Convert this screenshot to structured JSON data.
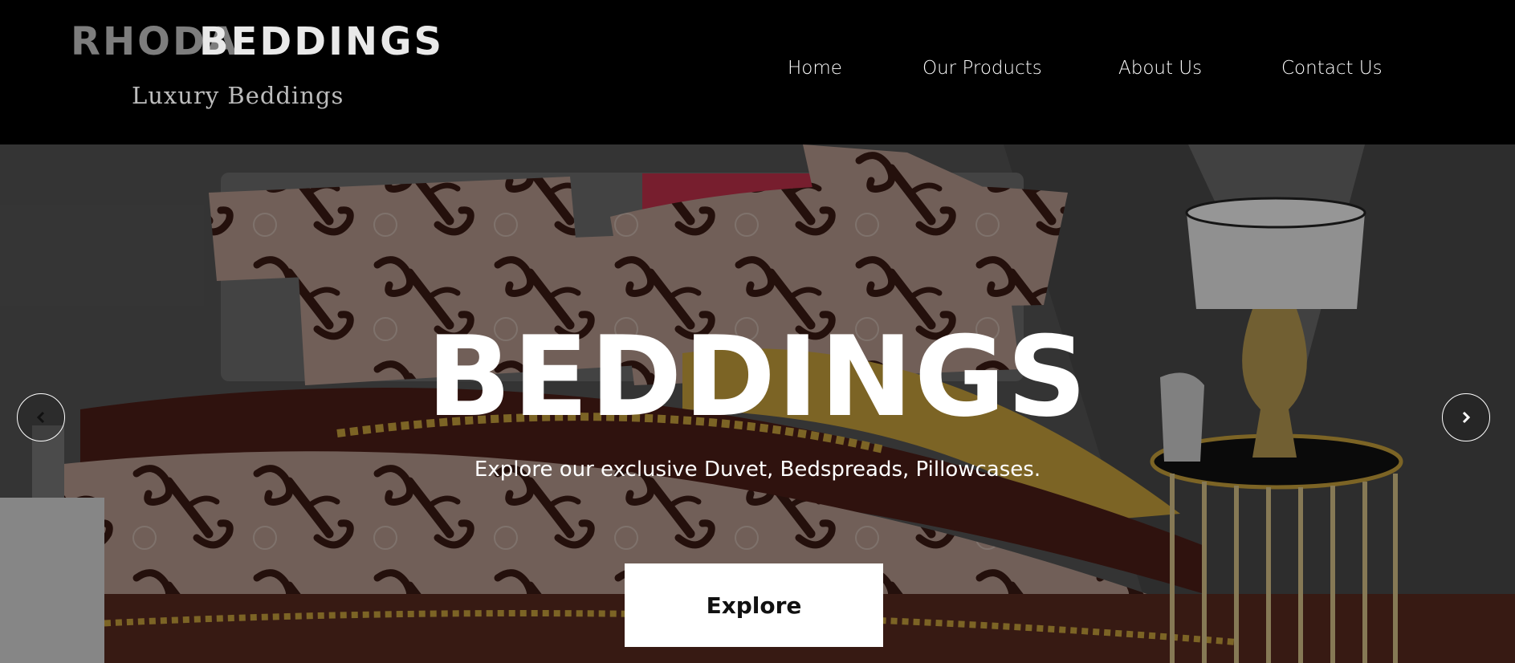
{
  "brand": {
    "name_part1": "RHODA",
    "name_part2": "BEDDINGS",
    "tagline": "Luxury Beddings"
  },
  "nav": {
    "items": [
      {
        "label": "Home"
      },
      {
        "label": "Our Products"
      },
      {
        "label": "About Us"
      },
      {
        "label": "Contact Us"
      }
    ]
  },
  "hero": {
    "title": "BEDDINGS",
    "subtitle": "Explore our exclusive Duvet, Bedspreads, Pillowcases.",
    "cta_label": "Explore",
    "prev_icon": "chevron-left-icon",
    "next_icon": "chevron-right-icon"
  },
  "colors": {
    "header_bg": "#000000",
    "logo_dim": "#7d7d7d",
    "logo_bright": "#e9e9e9",
    "tagline": "#bdbdbd",
    "duvet_base": "#b69a8e",
    "duvet_pattern": "#3a1a14",
    "accent_gold": "#c8a23c",
    "accent_red": "#c0314b",
    "button_bg": "#ffffff"
  }
}
